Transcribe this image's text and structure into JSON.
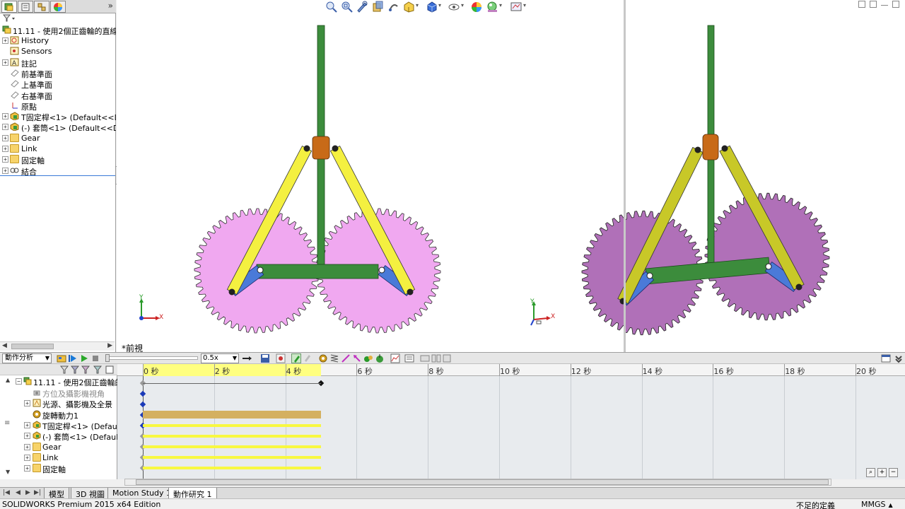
{
  "feature_tree": {
    "root": "11.11 - 使用2個正齒輪的直線運",
    "items": [
      {
        "label": "History",
        "expandable": true,
        "icon": "history-icon"
      },
      {
        "label": "Sensors",
        "expandable": false,
        "icon": "sensors-icon"
      },
      {
        "label": "註記",
        "expandable": true,
        "icon": "annotations-icon"
      },
      {
        "label": "前基準面",
        "expandable": false,
        "icon": "plane-icon"
      },
      {
        "label": "上基準面",
        "expandable": false,
        "icon": "plane-icon"
      },
      {
        "label": "右基準面",
        "expandable": false,
        "icon": "plane-icon"
      },
      {
        "label": "原點",
        "expandable": false,
        "icon": "origin-icon"
      },
      {
        "label": "T固定桿<1> (Default<<Def",
        "expandable": true,
        "icon": "part-icon"
      },
      {
        "label": "(-) 套筒<1> (Default<<Defa",
        "expandable": true,
        "icon": "part-icon"
      },
      {
        "label": "Gear",
        "expandable": true,
        "icon": "folder-icon"
      },
      {
        "label": "Link",
        "expandable": true,
        "icon": "folder-icon"
      },
      {
        "label": "固定軸",
        "expandable": true,
        "icon": "folder-icon"
      },
      {
        "label": "結合",
        "expandable": true,
        "icon": "mates-icon"
      }
    ]
  },
  "viewport": {
    "view_label": "*前視",
    "triad": {
      "x": "X",
      "y": "Y"
    }
  },
  "motion_manager": {
    "study_type": "動作分析",
    "playback_speed": "0.5x",
    "tree_root": "11.11 - 使用2個正齒輪的",
    "tree_items": [
      {
        "label": "方位及攝影機視角",
        "expandable": false,
        "icon": "camera-icon",
        "dimmed": true
      },
      {
        "label": "光源、攝影機及全景",
        "expandable": true,
        "icon": "lights-icon",
        "dimmed": false
      },
      {
        "label": "旋轉動力1",
        "expandable": false,
        "icon": "motor-icon",
        "dimmed": false
      },
      {
        "label": "T固定桿<1> (Default<",
        "expandable": true,
        "icon": "part-icon",
        "dimmed": false
      },
      {
        "label": "(-) 套筒<1> (Default<",
        "expandable": true,
        "icon": "part-icon",
        "dimmed": false
      },
      {
        "label": "Gear",
        "expandable": true,
        "icon": "folder-icon",
        "dimmed": false
      },
      {
        "label": "Link",
        "expandable": true,
        "icon": "folder-icon",
        "dimmed": false
      },
      {
        "label": "固定軸",
        "expandable": true,
        "icon": "folder-icon",
        "dimmed": false
      }
    ],
    "time_ticks": [
      "0 秒",
      "2 秒",
      "4 秒",
      "6 秒",
      "8 秒",
      "10 秒",
      "12 秒",
      "14 秒",
      "16 秒",
      "18 秒",
      "20 秒"
    ],
    "study_end_seconds": 5
  },
  "bottom_tabs": [
    "模型",
    "3D 視圖",
    "Motion Study 1",
    "動作研究 1"
  ],
  "active_tab_index": 3,
  "status": {
    "product": "SOLIDWORKS Premium 2015 x64 Edition",
    "definition": "不足的定義",
    "units": "MMGS"
  },
  "colors": {
    "gear_front": "#f0a8f0",
    "gear_iso": "#b070b8",
    "shaft": "#3c8c3c",
    "link": "#f4f040",
    "link_iso": "#c8c828",
    "bracket": "#4a7ad8",
    "sleeve": "#c86a18",
    "timeline_highlight": "#ffff80",
    "motor_bar": "#d4b060",
    "part_bar": "#f8f840"
  }
}
